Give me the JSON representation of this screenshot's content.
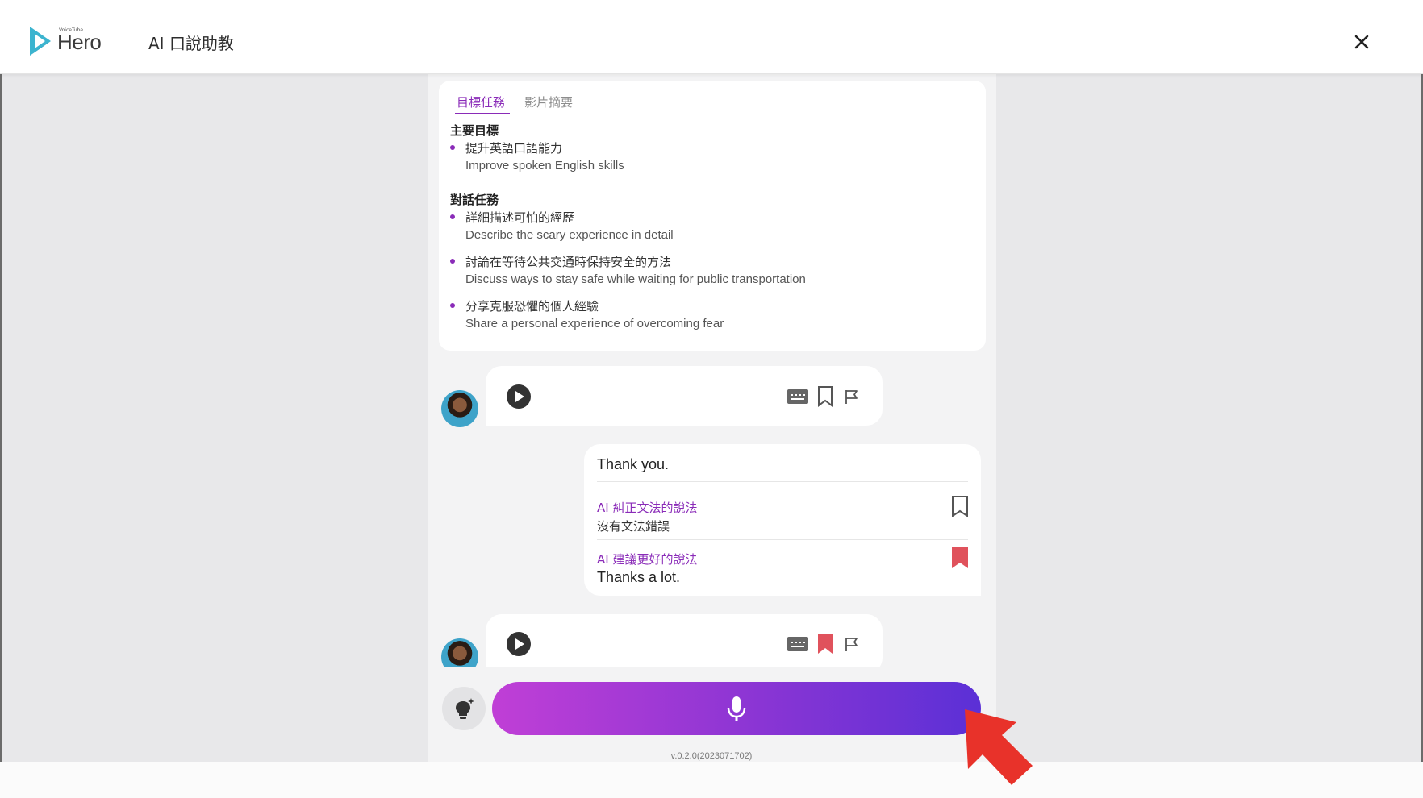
{
  "header": {
    "logo_small": "VoiceTube",
    "logo_text": "Hero",
    "title": "AI 口說助教",
    "close_icon": "close-icon"
  },
  "task_card": {
    "tabs": [
      "目標任務",
      "影片摘要"
    ],
    "active_tab": "目標任務",
    "main_goal_title": "主要目標",
    "main_goals": [
      {
        "zh": "提升英語口語能力",
        "en": "Improve spoken English skills"
      }
    ],
    "dialog_tasks_title": "對話任務",
    "dialog_tasks": [
      {
        "zh": "詳細描述可怕的經歷",
        "en": "Describe the scary experience in detail"
      },
      {
        "zh": "討論在等待公共交通時保持安全的方法",
        "en": "Discuss ways to stay safe while waiting for public transportation"
      },
      {
        "zh": "分享克服恐懼的個人經驗",
        "en": "Share a personal experience of overcoming fear"
      }
    ]
  },
  "messages": {
    "ai_1": {
      "icons": [
        "play-icon",
        "subtitle-icon",
        "bookmark-outline-icon",
        "flag-icon"
      ],
      "bookmarked": false
    },
    "user": {
      "text": "Thank you.",
      "grammar_label": "AI 糾正文法的說法",
      "grammar_value": "沒有文法錯誤",
      "grammar_bookmarked": false,
      "suggest_label": "AI 建議更好的說法",
      "suggest_value": "Thanks a lot.",
      "suggest_bookmarked": true
    },
    "ai_2": {
      "icons": [
        "play-icon",
        "subtitle-icon",
        "bookmark-filled-icon",
        "flag-icon"
      ],
      "bookmarked": true
    }
  },
  "input": {
    "hint_icon": "lightbulb-icon",
    "mic_icon": "microphone-icon"
  },
  "version": "v.0.2.0(2023071702)",
  "colors": {
    "accent": "#8a2bb8",
    "bookmark_active": "#e0525c",
    "mic_gradient_start": "#c03fd6",
    "mic_gradient_end": "#5b30d6",
    "arrow": "#e8322a"
  }
}
